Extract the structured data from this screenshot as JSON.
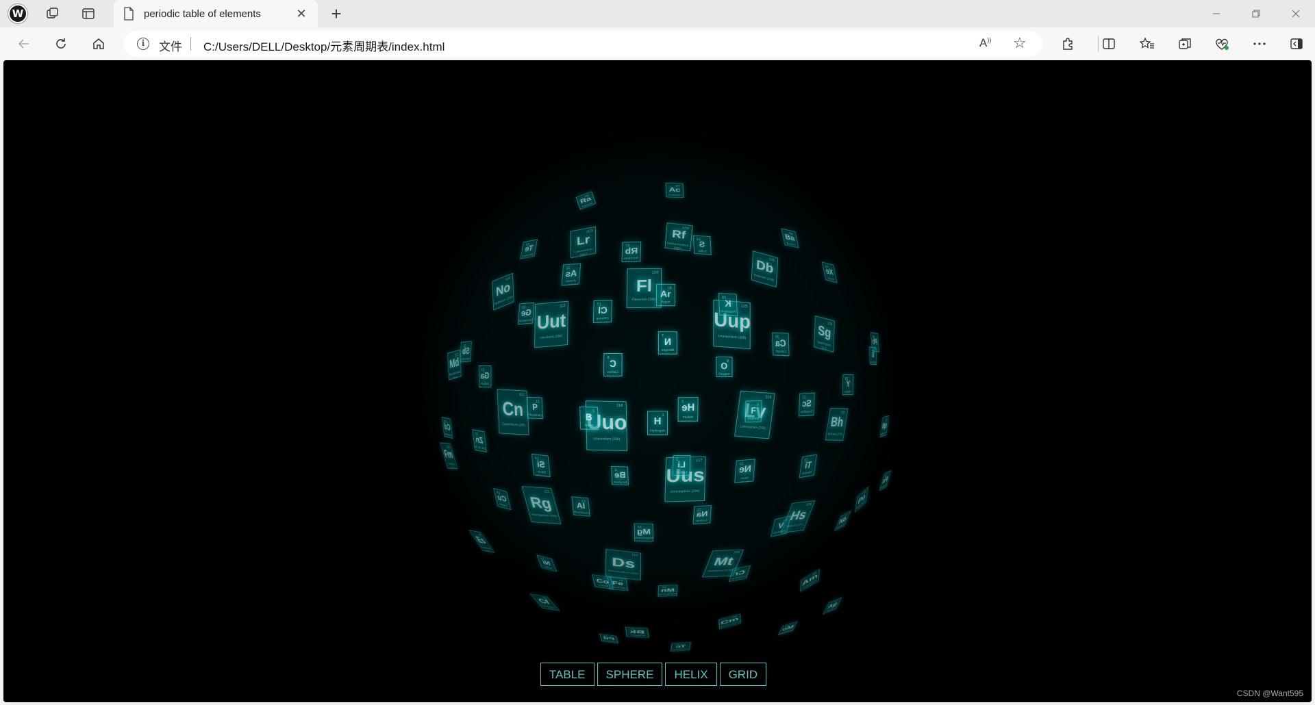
{
  "browser": {
    "tab": {
      "title": "periodic table of elements"
    },
    "address": {
      "scheme_label": "文件",
      "url": "C:/Users/DELL/Desktop/元素周期表/index.html"
    }
  },
  "page": {
    "colors": {
      "background": "#000000",
      "card_fill": "rgba(0,127,127,0.55)",
      "card_border": "rgba(127,255,255,0.55)",
      "accent": "#7fffff"
    },
    "buttons": [
      "TABLE",
      "SPHERE",
      "HELIX",
      "GRID"
    ],
    "watermark": "CSDN @Want595",
    "elements_visible": [
      {
        "s": "Fl",
        "n": 114,
        "name": "Flerovium",
        "m": "(289)"
      },
      {
        "s": "Uut",
        "n": 113,
        "name": "Ununtrium",
        "m": "(284)"
      },
      {
        "s": "Uup",
        "n": 115,
        "name": "Ununpentium",
        "m": "(288)"
      },
      {
        "s": "Uuo",
        "n": 118,
        "name": "Ununoctium",
        "m": "(294)"
      },
      {
        "s": "Uus",
        "n": 117,
        "name": "Ununseptium",
        "m": "(294)"
      },
      {
        "s": "Cn",
        "n": 112,
        "name": "Copernicium",
        "m": "(285)"
      },
      {
        "s": "Lv",
        "n": 116,
        "name": "Livermorium",
        "m": "(293)"
      },
      {
        "s": "Rg",
        "n": 111,
        "name": "Roentgenium",
        "m": "(280)"
      },
      {
        "s": "Ds",
        "n": 110,
        "name": "Darmstadtium",
        "m": "(281)"
      },
      {
        "s": "Mt",
        "n": 109,
        "name": "Meitnerium",
        "m": "(276)"
      },
      {
        "s": "Hs",
        "n": 108,
        "name": "Hassium",
        "m": "(277)"
      },
      {
        "s": "Bh",
        "n": 107,
        "name": "Bohrium",
        "m": "(272)"
      },
      {
        "s": "Sg",
        "n": 106,
        "name": "Seaborgium",
        "m": "(271)"
      },
      {
        "s": "Db",
        "n": 105,
        "name": "Dubnium",
        "m": "(268)"
      },
      {
        "s": "Rf",
        "n": 104,
        "name": "Rutherfordium",
        "m": "(267)"
      },
      {
        "s": "Lr",
        "n": 103,
        "name": "Lawrencium",
        "m": "(262)"
      },
      {
        "s": "No",
        "n": 102,
        "name": "Nobelium",
        "m": "(259)"
      },
      {
        "s": "Md",
        "n": 101,
        "name": "Mendelevium",
        "m": "(258)"
      },
      {
        "s": "Fm",
        "n": 100,
        "name": "Fermium",
        "m": "(257)"
      },
      {
        "s": "Es",
        "n": 99,
        "name": "Einsteinium",
        "m": "(252)"
      },
      {
        "s": "Cf",
        "n": 98,
        "name": "Californium",
        "m": "(251)"
      },
      {
        "s": "Bk",
        "n": 97,
        "name": "Berkelium",
        "m": "(247)"
      },
      {
        "s": "Cm",
        "n": 96,
        "name": "Curium",
        "m": "(247)"
      },
      {
        "s": "Am",
        "n": 95,
        "name": "Americium",
        "m": "(243)"
      },
      {
        "s": "Pu",
        "n": 94,
        "name": "Plutonium",
        "m": "(244)"
      },
      {
        "s": "Np",
        "n": 93,
        "name": "Neptunium",
        "m": "(237)"
      },
      {
        "s": "Ac",
        "n": 89,
        "name": "Actinium",
        "m": "(227)"
      },
      {
        "s": "Ra",
        "n": 88,
        "name": "Radium",
        "m": "(226)"
      },
      {
        "s": "H",
        "n": 1,
        "name": "Hydrogen",
        "m": "1.00794"
      },
      {
        "s": "He",
        "n": 2,
        "name": "Helium",
        "m": "4.002602"
      },
      {
        "s": "Li",
        "n": 3,
        "name": "Lithium",
        "m": "6.941"
      },
      {
        "s": "Be",
        "n": 4,
        "name": "Beryllium",
        "m": "9.012182"
      },
      {
        "s": "B",
        "n": 5,
        "name": "Boron",
        "m": "10.811"
      },
      {
        "s": "C",
        "n": 6,
        "name": "Carbon",
        "m": "12.0107"
      },
      {
        "s": "N",
        "n": 7,
        "name": "Nitrogen",
        "m": "14.0067"
      },
      {
        "s": "O",
        "n": 8,
        "name": "Oxygen",
        "m": "15.9994"
      },
      {
        "s": "F",
        "n": 9,
        "name": "Fluorine",
        "m": "18.9984032"
      },
      {
        "s": "Ne",
        "n": 10,
        "name": "Neon",
        "m": "20.1797"
      },
      {
        "s": "Na",
        "n": 11,
        "name": "Sodium",
        "m": "22.98976928"
      },
      {
        "s": "Mg",
        "n": 12,
        "name": "Magnesium",
        "m": "24.305"
      },
      {
        "s": "Al",
        "n": 13,
        "name": "Aluminium",
        "m": "26.9815386"
      },
      {
        "s": "Si",
        "n": 14,
        "name": "Silicon",
        "m": "28.0855"
      },
      {
        "s": "P",
        "n": 15,
        "name": "Phosphorus",
        "m": "30.973762"
      },
      {
        "s": "S",
        "n": 16,
        "name": "Sulfur",
        "m": "32.065"
      },
      {
        "s": "Cl",
        "n": 17,
        "name": "Chlorine",
        "m": "35.453"
      },
      {
        "s": "Ar",
        "n": 18,
        "name": "Argon",
        "m": "39.948"
      },
      {
        "s": "K",
        "n": 19,
        "name": "Potassium",
        "m": "39.948"
      },
      {
        "s": "Ca",
        "n": 20,
        "name": "Calcium",
        "m": "40.078"
      },
      {
        "s": "Sc",
        "n": 21,
        "name": "Scandium",
        "m": "44.955912"
      },
      {
        "s": "Ti",
        "n": 22,
        "name": "Titanium",
        "m": "47.867"
      },
      {
        "s": "V",
        "n": 23,
        "name": "Vanadium",
        "m": "50.9415"
      },
      {
        "s": "Cr",
        "n": 24,
        "name": "Chromium",
        "m": "51.9961"
      },
      {
        "s": "Mn",
        "n": 25,
        "name": "Manganese",
        "m": "54.938045"
      },
      {
        "s": "Fe",
        "n": 26,
        "name": "Iron",
        "m": "55.845"
      },
      {
        "s": "Co",
        "n": 27,
        "name": "Cobalt",
        "m": "58.933195"
      },
      {
        "s": "Ni",
        "n": 28,
        "name": "Nickel",
        "m": "58.6934"
      },
      {
        "s": "Cu",
        "n": 29,
        "name": "Copper",
        "m": "63.546"
      },
      {
        "s": "Zn",
        "n": 30,
        "name": "Zinc",
        "m": "65.38"
      },
      {
        "s": "Ga",
        "n": 31,
        "name": "Gallium",
        "m": "69.723"
      },
      {
        "s": "Ge",
        "n": 32,
        "name": "Germanium",
        "m": "72.63"
      },
      {
        "s": "As",
        "n": 33,
        "name": "Arsenic",
        "m": "74.9216"
      },
      {
        "s": "Rb",
        "n": 37,
        "name": "Rubidium",
        "m": "85.4678"
      },
      {
        "s": "Y",
        "n": 39,
        "name": "Yttrium",
        "m": "88.90585"
      },
      {
        "s": "Nb",
        "n": 41,
        "name": "Niobium",
        "m": "92.90638"
      },
      {
        "s": "Mo",
        "n": 42,
        "name": "Molybdenum",
        "m": "95.96"
      },
      {
        "s": "Tc",
        "n": 43,
        "name": "Technetium",
        "m": "(98)"
      },
      {
        "s": "Pd",
        "n": 46,
        "name": "Palladium",
        "m": "106.42"
      },
      {
        "s": "Ag",
        "n": 47,
        "name": "Silver",
        "m": "107.8682"
      },
      {
        "s": "Cd",
        "n": 48,
        "name": "Cadmium",
        "m": "112.411"
      },
      {
        "s": "Sb",
        "n": 51,
        "name": "Antimony",
        "m": "121.76"
      },
      {
        "s": "Te",
        "n": 52,
        "name": "Tellurium",
        "m": "127.6"
      },
      {
        "s": "Xe",
        "n": 54,
        "name": "Xenon",
        "m": "131.293"
      },
      {
        "s": "Ba",
        "n": 56,
        "name": "Barium",
        "m": "137.327"
      },
      {
        "s": "Pb",
        "n": 82,
        "name": "Lead",
        "m": "207.2"
      },
      {
        "s": "Pa",
        "n": 91,
        "name": "Protactinium",
        "m": "231.03588"
      },
      {
        "s": "U",
        "n": 92,
        "name": "Uranium",
        "m": "238.02891"
      }
    ]
  }
}
